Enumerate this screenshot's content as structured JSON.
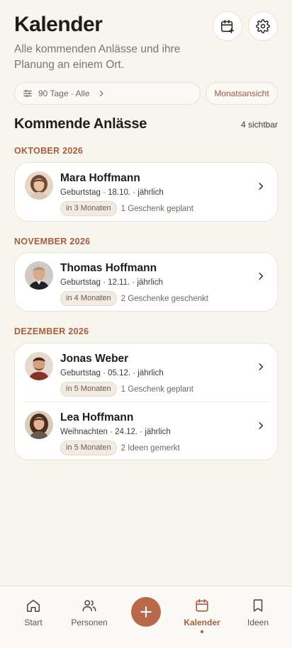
{
  "header": {
    "title": "Kalender",
    "subtitle": "Alle kommenden Anlässe und ihre Planung an einem Ort."
  },
  "filter": {
    "label": "90 Tage · Alle",
    "month_view_label": "Monatsansicht"
  },
  "section": {
    "title": "Kommende Anlässe",
    "count_label": "4 sichtbar"
  },
  "groups": [
    {
      "month": "OKTOBER 2026",
      "events": [
        {
          "name": "Mara Hoffmann",
          "meta": "Geburtstag · 18.10. · jährlich",
          "countdown": "in 3 Monaten",
          "note": "1 Geschenk geplant"
        }
      ]
    },
    {
      "month": "NOVEMBER 2026",
      "events": [
        {
          "name": "Thomas Hoffmann",
          "meta": "Geburtstag · 12.11. · jährlich",
          "countdown": "in 4 Monaten",
          "note": "2 Geschenke geschenkt"
        }
      ]
    },
    {
      "month": "DEZEMBER 2026",
      "events": [
        {
          "name": "Jonas Weber",
          "meta": "Geburtstag · 05.12. · jährlich",
          "countdown": "in 5 Monaten",
          "note": "1 Geschenk geplant"
        },
        {
          "name": "Lea Hoffmann",
          "meta": "Weihnachten · 24.12. · jährlich",
          "countdown": "in 5 Monaten",
          "note": "2 Ideen gemerkt"
        }
      ]
    }
  ],
  "tabbar": {
    "tabs": [
      {
        "label": "Start",
        "icon": "home-icon"
      },
      {
        "label": "Personen",
        "icon": "people-icon"
      },
      {
        "label": "Kalender",
        "icon": "calendar-icon",
        "active": true
      },
      {
        "label": "Ideen",
        "icon": "bookmark-icon"
      }
    ],
    "add_icon": "plus-icon"
  },
  "colors": {
    "accent": "#a65d3a",
    "fab": "#b7694a",
    "background": "#f8f5ef",
    "card": "#ffffff"
  }
}
